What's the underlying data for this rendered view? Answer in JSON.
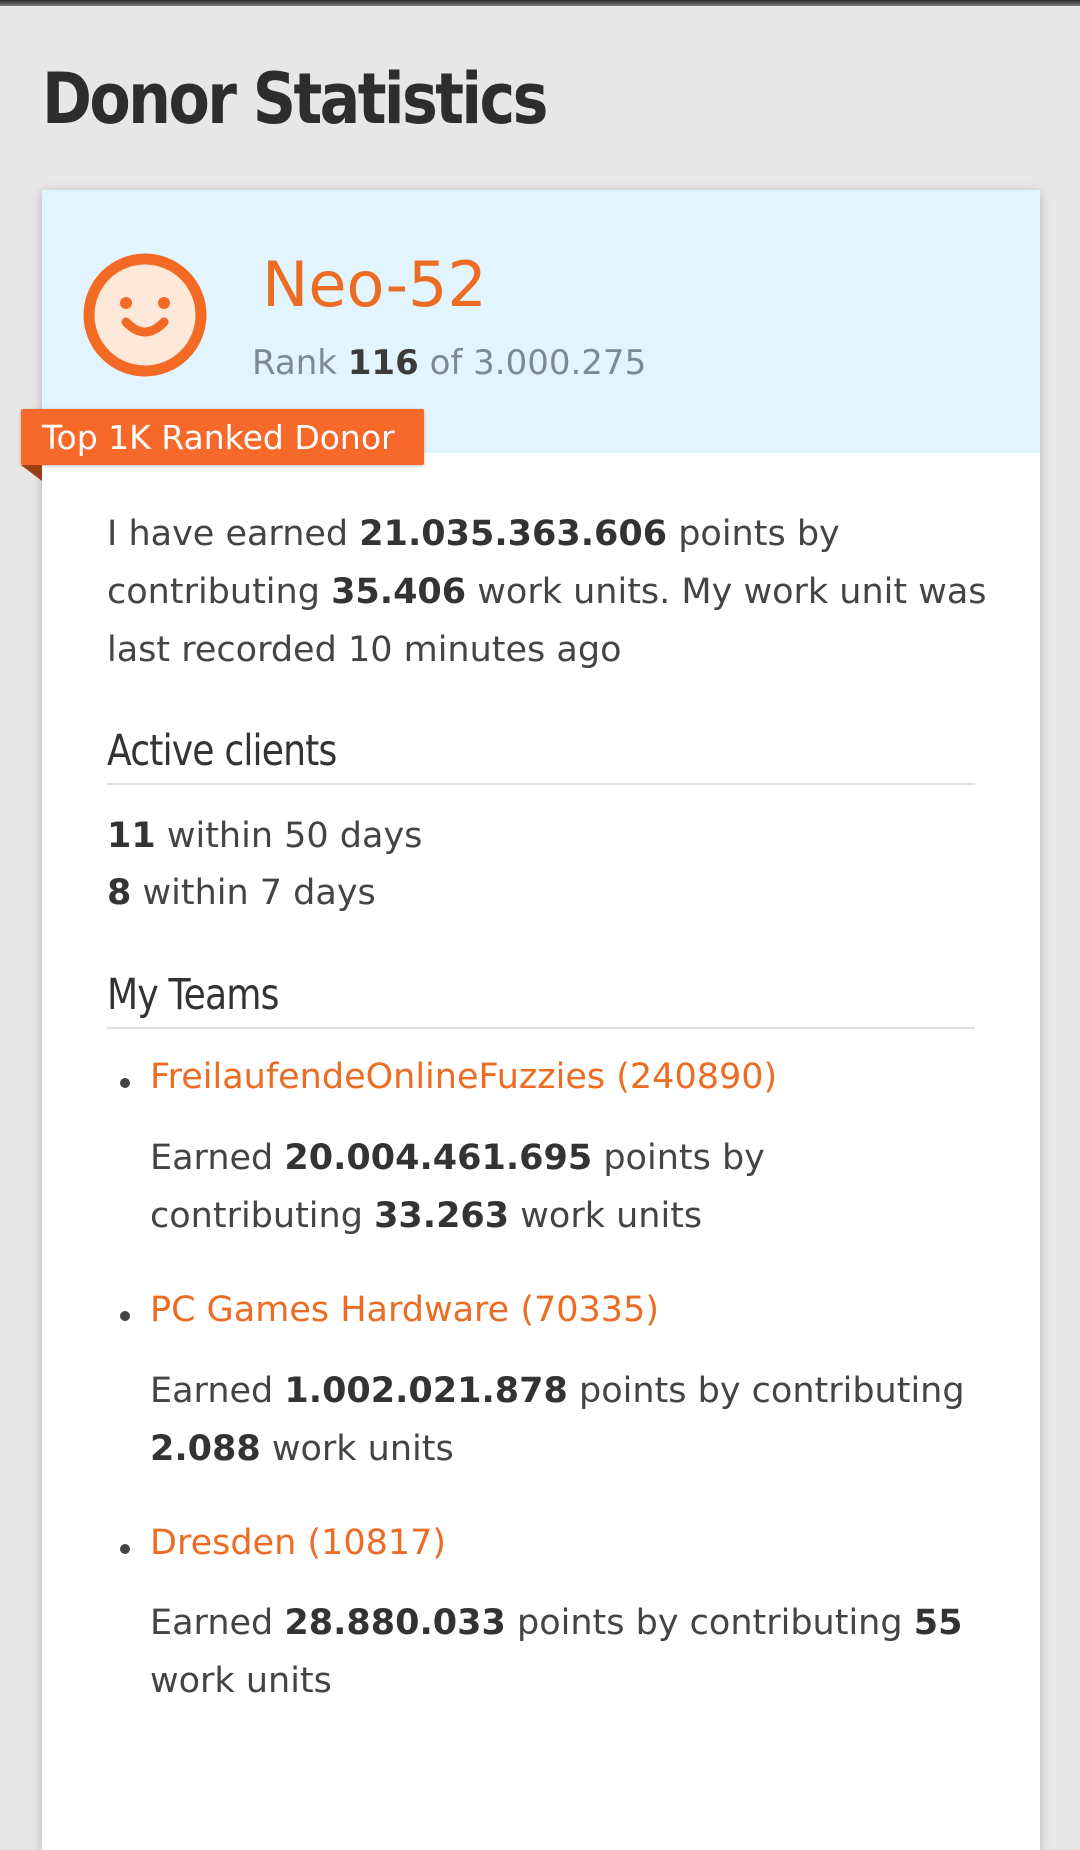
{
  "page": {
    "title": "Donor Statistics"
  },
  "donor": {
    "name": "Neo-52",
    "rank_prefix": "Rank",
    "rank": "116",
    "rank_of": "of",
    "rank_total": "3.000.275",
    "badge": "Top 1K Ranked Donor",
    "avatar_icon": "smiley-face-icon",
    "accent_color": "#ed6c23"
  },
  "summary": {
    "prefix": "I have earned",
    "points": "21.035.363.606",
    "middle": "points by contributing",
    "work_units": "35.406",
    "suffix": "work units. My work unit was last recorded",
    "last_recorded": "10 minutes ago"
  },
  "active_clients": {
    "heading": "Active clients",
    "rows": [
      {
        "count": "11",
        "label": "within 50 days"
      },
      {
        "count": "8",
        "label": "within 7 days"
      }
    ]
  },
  "teams": {
    "heading": "My Teams",
    "earned_label": "Earned",
    "points_label": "points by contributing",
    "units_label": "work units",
    "items": [
      {
        "name": "FreilaufendeOnlineFuzzies (240890)",
        "points": "20.004.461.695",
        "work_units": "33.263"
      },
      {
        "name": "PC Games Hardware (70335)",
        "points": "1.002.021.878",
        "work_units": "2.088"
      },
      {
        "name": "Dresden (10817)",
        "points": "28.880.033",
        "work_units": "55"
      }
    ]
  }
}
